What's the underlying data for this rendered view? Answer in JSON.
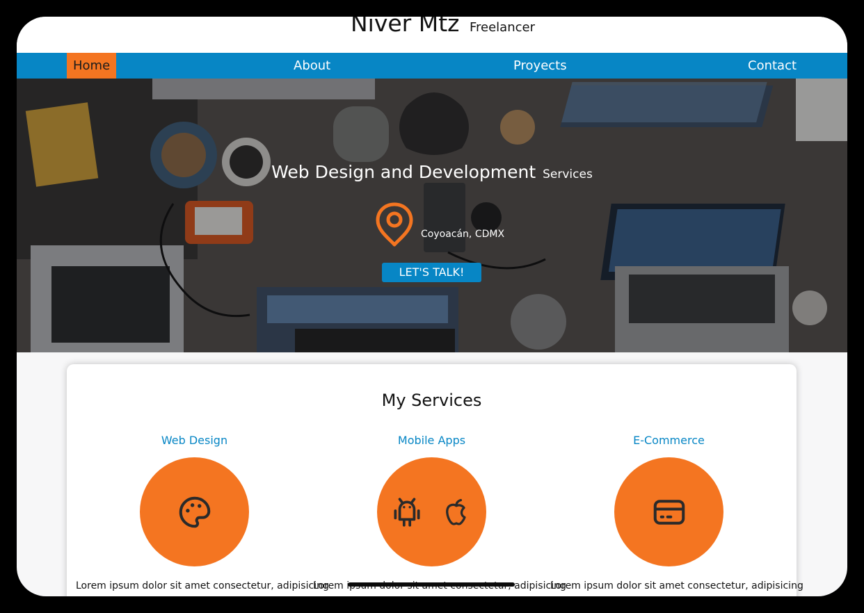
{
  "brand": {
    "name": "Niver Mtz",
    "role": "Freelancer"
  },
  "nav": {
    "items": [
      {
        "label": "Home",
        "active": true
      },
      {
        "label": "About",
        "active": false
      },
      {
        "label": "Proyects",
        "active": false
      },
      {
        "label": "Contact",
        "active": false
      }
    ]
  },
  "hero": {
    "title": "Web Design and Development",
    "title_suffix": "Services",
    "location_icon": "map-pin-icon",
    "location": "Coyoacán, CDMX",
    "cta_label": "LET'S TALK!"
  },
  "services": {
    "heading": "My Services",
    "items": [
      {
        "title": "Web Design",
        "icons": [
          "palette-icon"
        ],
        "text": "Lorem ipsum dolor sit amet consectetur, adipisicing"
      },
      {
        "title": "Mobile Apps",
        "icons": [
          "android-icon",
          "apple-icon"
        ],
        "text": "Lorem ipsum dolor sit amet consectetur, adipisicing"
      },
      {
        "title": "E-Commerce",
        "icons": [
          "credit-card-icon"
        ],
        "text": "Lorem ipsum dolor sit amet consectetur, adipisicing"
      }
    ]
  },
  "colors": {
    "primary": "#0786c5",
    "accent": "#f47521",
    "nav_text": "#ffffff"
  }
}
